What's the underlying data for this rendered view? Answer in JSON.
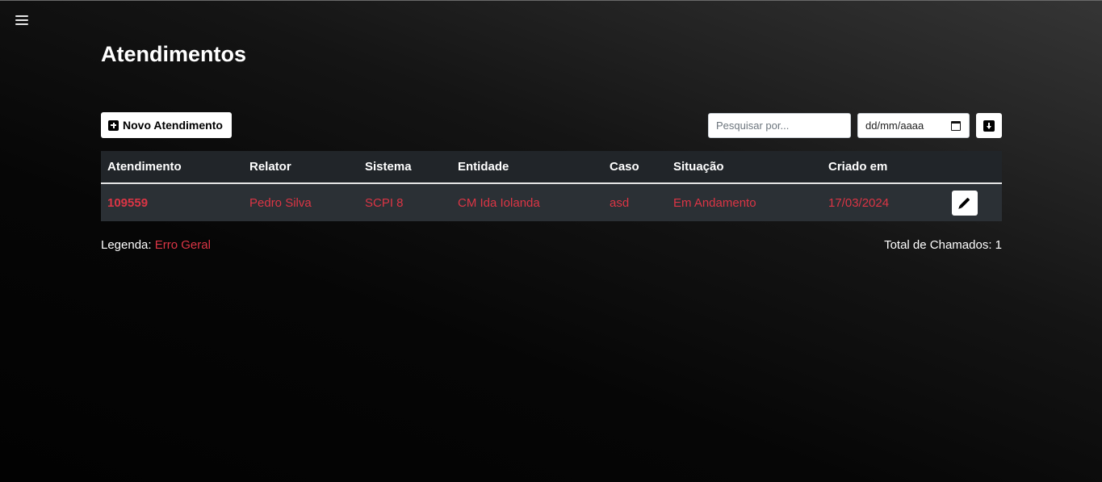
{
  "page": {
    "title": "Atendimentos"
  },
  "toolbar": {
    "new_button_label": "Novo Atendimento",
    "search_placeholder": "Pesquisar por...",
    "date_placeholder": "dd/mm/aaaa"
  },
  "table": {
    "headers": [
      "Atendimento",
      "Relator",
      "Sistema",
      "Entidade",
      "Caso",
      "Situação",
      "Criado em"
    ],
    "rows": [
      {
        "atendimento": "109559",
        "relator": "Pedro Silva",
        "sistema": "SCPI 8",
        "entidade": "CM Ida Iolanda",
        "caso": "asd",
        "situacao": "Em Andamento",
        "criado_em": "17/03/2024"
      }
    ]
  },
  "footer": {
    "legend_label": "Legenda:",
    "legend_value": "Erro Geral",
    "total_text": "Total de Chamados: 1"
  },
  "colors": {
    "accent_red": "#dc3545",
    "header_bg": "#212529",
    "row_bg": "#2b3035"
  },
  "icons": [
    "hamburger-menu-icon",
    "plus-square-icon",
    "calendar-icon",
    "download-icon",
    "pencil-icon"
  ]
}
